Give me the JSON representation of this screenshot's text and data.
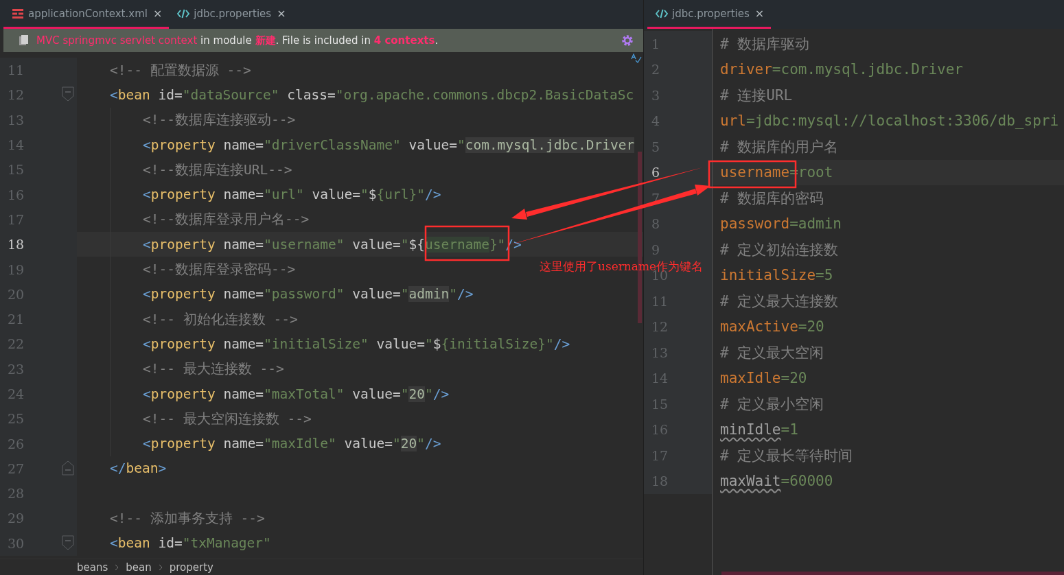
{
  "left_pane": {
    "tabs": [
      {
        "label": "applicationContext.xml",
        "kind": "xml",
        "selected": true,
        "close": "×"
      },
      {
        "label": "jdbc.properties",
        "kind": "properties",
        "selected": false,
        "close": "×"
      }
    ],
    "banner": {
      "segments": [
        {
          "text": "MVC springmvc servlet context",
          "kind": "link"
        },
        {
          "text": " in module ",
          "kind": "plain"
        },
        {
          "text": "新建",
          "kind": "strong_link"
        },
        {
          "text": ". File is included in ",
          "kind": "plain"
        },
        {
          "text": "4 contexts",
          "kind": "strong_link"
        },
        {
          "text": ".",
          "kind": "plain"
        }
      ]
    },
    "lines": [
      {
        "number": "11",
        "current": false,
        "tokens": [
          {
            "kind": "c",
            "text": "<!-- 配置数据源 -->"
          }
        ]
      },
      {
        "number": "12",
        "current": false,
        "kind": "open",
        "tokens": [
          {
            "kind": "b",
            "text": "<"
          },
          {
            "kind": "t",
            "text": "bean"
          },
          {
            "kind": "a",
            "text": " id="
          },
          {
            "kind": "s",
            "text": "\"dataSource\""
          },
          {
            "kind": "a",
            "text": " class="
          },
          {
            "kind": "s",
            "text": "\"org.apache.commons.dbcp2.BasicDataSc"
          }
        ],
        "children": [
          {
            "number": "13",
            "current": false,
            "tokens": [
              {
                "kind": "c",
                "text": "<!--数据库连接驱动-->"
              }
            ]
          },
          {
            "number": "14",
            "current": false,
            "tokens": [
              {
                "kind": "b",
                "text": "<"
              },
              {
                "kind": "t",
                "text": "property"
              },
              {
                "kind": "a",
                "text": " name="
              },
              {
                "kind": "s",
                "text": "\"driverClassName\""
              },
              {
                "kind": "a",
                "text": " value="
              },
              {
                "kind": "s",
                "text": "\""
              },
              {
                "kind": "h",
                "text": "com.mysql.jdbc.Driver"
              }
            ]
          },
          {
            "number": "15",
            "current": false,
            "tokens": [
              {
                "kind": "c",
                "text": "<!--数据库连接URL-->"
              }
            ]
          },
          {
            "number": "16",
            "current": false,
            "tokens": [
              {
                "kind": "b",
                "text": "<"
              },
              {
                "kind": "t",
                "text": "property"
              },
              {
                "kind": "a",
                "text": " name="
              },
              {
                "kind": "s",
                "text": "\"url\""
              },
              {
                "kind": "a",
                "text": " value="
              },
              {
                "kind": "s",
                "text": "\""
              },
              {
                "kind": "a",
                "text": "$"
              },
              {
                "kind": "s",
                "text": "{url}\""
              },
              {
                "kind": "b",
                "text": "/>"
              }
            ]
          },
          {
            "number": "17",
            "current": false,
            "tokens": [
              {
                "kind": "c",
                "text": "<!--数据库登录用户名-->"
              }
            ]
          },
          {
            "number": "18",
            "current": true,
            "tokens": [
              {
                "kind": "b",
                "text": "<"
              },
              {
                "kind": "t",
                "text": "property"
              },
              {
                "kind": "a",
                "text": " name="
              },
              {
                "kind": "s",
                "text": "\"username\""
              },
              {
                "kind": "a",
                "text": " value="
              },
              {
                "kind": "s",
                "text": "\""
              },
              {
                "kind": "a",
                "text": "${"
              },
              {
                "kind": "v",
                "text": "username"
              },
              {
                "kind": "s",
                "text": "}\""
              },
              {
                "kind": "b",
                "text": "/>"
              }
            ]
          },
          {
            "number": "19",
            "current": false,
            "tokens": [
              {
                "kind": "c",
                "text": "<!--数据库登录密码-->"
              }
            ]
          },
          {
            "number": "20",
            "current": false,
            "tokens": [
              {
                "kind": "b",
                "text": "<"
              },
              {
                "kind": "t",
                "text": "property"
              },
              {
                "kind": "a",
                "text": " name="
              },
              {
                "kind": "s",
                "text": "\"password\""
              },
              {
                "kind": "a",
                "text": " value="
              },
              {
                "kind": "s",
                "text": "\""
              },
              {
                "kind": "h",
                "text": "admin"
              },
              {
                "kind": "s",
                "text": "\""
              },
              {
                "kind": "b",
                "text": "/>"
              }
            ]
          },
          {
            "number": "21",
            "current": false,
            "tokens": [
              {
                "kind": "c",
                "text": "<!-- 初始化连接数 -->"
              }
            ]
          },
          {
            "number": "22",
            "current": false,
            "tokens": [
              {
                "kind": "b",
                "text": "<"
              },
              {
                "kind": "t",
                "text": "property"
              },
              {
                "kind": "a",
                "text": " name="
              },
              {
                "kind": "s",
                "text": "\"initialSize\""
              },
              {
                "kind": "a",
                "text": " value="
              },
              {
                "kind": "s",
                "text": "\""
              },
              {
                "kind": "a",
                "text": "$"
              },
              {
                "kind": "s",
                "text": "{initialSize}\""
              },
              {
                "kind": "b",
                "text": "/>"
              }
            ]
          },
          {
            "number": "23",
            "current": false,
            "tokens": [
              {
                "kind": "c",
                "text": "<!-- 最大连接数 -->"
              }
            ]
          },
          {
            "number": "24",
            "current": false,
            "tokens": [
              {
                "kind": "b",
                "text": "<"
              },
              {
                "kind": "t",
                "text": "property"
              },
              {
                "kind": "a",
                "text": " name="
              },
              {
                "kind": "s",
                "text": "\"maxTotal\""
              },
              {
                "kind": "a",
                "text": " value="
              },
              {
                "kind": "s",
                "text": "\""
              },
              {
                "kind": "h",
                "text": "20"
              },
              {
                "kind": "s",
                "text": "\""
              },
              {
                "kind": "b",
                "text": "/>"
              }
            ]
          },
          {
            "number": "25",
            "current": false,
            "tokens": [
              {
                "kind": "c",
                "text": "<!-- 最大空闲连接数 -->"
              }
            ]
          },
          {
            "number": "26",
            "current": false,
            "tokens": [
              {
                "kind": "b",
                "text": "<"
              },
              {
                "kind": "t",
                "text": "property"
              },
              {
                "kind": "a",
                "text": " name="
              },
              {
                "kind": "s",
                "text": "\"maxIdle\""
              },
              {
                "kind": "a",
                "text": " value="
              },
              {
                "kind": "s",
                "text": "\""
              },
              {
                "kind": "h",
                "text": "20"
              },
              {
                "kind": "s",
                "text": "\""
              },
              {
                "kind": "b",
                "text": "/>"
              }
            ]
          }
        ]
      },
      {
        "number": "27",
        "current": false,
        "kind": "close",
        "tokens": [
          {
            "kind": "b",
            "text": "</"
          },
          {
            "kind": "t",
            "text": "bean"
          },
          {
            "kind": "b",
            "text": ">"
          }
        ]
      },
      {
        "number": "28",
        "current": false
      },
      {
        "number": "29",
        "current": false,
        "tokens": [
          {
            "kind": "c",
            "text": "<!-- 添加事务支持 -->"
          }
        ]
      },
      {
        "number": "30",
        "current": false,
        "kind": "open",
        "tokens": [
          {
            "kind": "b",
            "text": "<"
          },
          {
            "kind": "t",
            "text": "bean"
          },
          {
            "kind": "a",
            "text": " id="
          },
          {
            "kind": "s",
            "text": "\"txManager\""
          }
        ]
      }
    ],
    "breadcrumb": [
      "beans",
      "bean",
      "property"
    ]
  },
  "right_pane": {
    "tabs": [
      {
        "label": "jdbc.properties",
        "kind": "properties",
        "selected": true,
        "close": "×"
      }
    ],
    "lines": [
      {
        "number": "1",
        "current": false,
        "tokens": [
          {
            "kind": "c",
            "text": "# 数据库驱动"
          }
        ]
      },
      {
        "number": "2",
        "current": false,
        "tokens": [
          {
            "kind": "k",
            "text": "driver"
          },
          {
            "kind": "s",
            "text": "=com.mysql.jdbc.Driver"
          }
        ]
      },
      {
        "number": "3",
        "current": false,
        "tokens": [
          {
            "kind": "c",
            "text": "# 连接URL"
          }
        ]
      },
      {
        "number": "4",
        "current": false,
        "tokens": [
          {
            "kind": "k",
            "text": "url"
          },
          {
            "kind": "s",
            "text": "=jdbc:mysql://localhost:3306/db_spri"
          }
        ]
      },
      {
        "number": "5",
        "current": false,
        "tokens": [
          {
            "kind": "c",
            "text": "# 数据库的用户名"
          }
        ]
      },
      {
        "number": "6",
        "current": true,
        "tokens": [
          {
            "kind": "k",
            "text": "username"
          },
          {
            "kind": "s",
            "text": "="
          },
          {
            "kind": "s",
            "text": "root"
          }
        ]
      },
      {
        "number": "7",
        "current": false,
        "tokens": [
          {
            "kind": "c",
            "text": "# 数据库的密码"
          }
        ]
      },
      {
        "number": "8",
        "current": false,
        "tokens": [
          {
            "kind": "k",
            "text": "password"
          },
          {
            "kind": "s",
            "text": "=admin"
          }
        ]
      },
      {
        "number": "9",
        "current": false,
        "tokens": [
          {
            "kind": "c",
            "text": "# 定义初始连接数"
          }
        ]
      },
      {
        "number": "10",
        "current": false,
        "tokens": [
          {
            "kind": "k",
            "text": "initialSize"
          },
          {
            "kind": "s",
            "text": "=5"
          }
        ]
      },
      {
        "number": "11",
        "current": false,
        "tokens": [
          {
            "kind": "c",
            "text": "# 定义最大连接数"
          }
        ]
      },
      {
        "number": "12",
        "current": false,
        "tokens": [
          {
            "kind": "k",
            "text": "maxActive"
          },
          {
            "kind": "s",
            "text": "=20"
          }
        ]
      },
      {
        "number": "13",
        "current": false,
        "tokens": [
          {
            "kind": "c",
            "text": "# 定义最大空闲"
          }
        ]
      },
      {
        "number": "14",
        "current": false,
        "tokens": [
          {
            "kind": "k",
            "text": "maxIdle"
          },
          {
            "kind": "s",
            "text": "=20"
          }
        ]
      },
      {
        "number": "15",
        "current": false,
        "tokens": [
          {
            "kind": "c",
            "text": "# 定义最小空闲"
          }
        ]
      },
      {
        "number": "16",
        "current": false,
        "tokens": [
          {
            "kind": "u",
            "text": "minIdle"
          },
          {
            "kind": "s",
            "text": "=1"
          }
        ]
      },
      {
        "number": "17",
        "current": false,
        "tokens": [
          {
            "kind": "c",
            "text": "# 定义最长等待时间"
          }
        ]
      },
      {
        "number": "18",
        "current": false,
        "tokens": [
          {
            "kind": "u",
            "text": "maxWait"
          },
          {
            "kind": "s",
            "text": "=60000"
          }
        ]
      }
    ]
  },
  "annotation": {
    "note": "这里使用了username作为键名"
  }
}
